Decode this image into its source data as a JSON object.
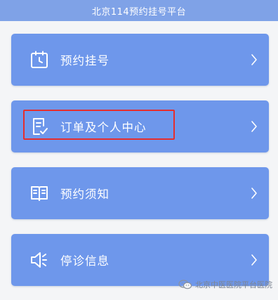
{
  "header": {
    "title": "北京114预约挂号平台"
  },
  "menu": [
    {
      "label": "预约挂号",
      "icon": "calendar-clock-icon"
    },
    {
      "label": "订单及个人中心",
      "icon": "order-document-icon"
    },
    {
      "label": "预约须知",
      "icon": "open-book-icon"
    },
    {
      "label": "停诊信息",
      "icon": "speaker-icon"
    }
  ],
  "colors": {
    "header_bg": "#7fa2e7",
    "button_bg": "#6e97eb",
    "highlight": "#e52e2e"
  },
  "watermark": {
    "text": "北京中医医院平台医院",
    "icon": "wechat-icon"
  }
}
